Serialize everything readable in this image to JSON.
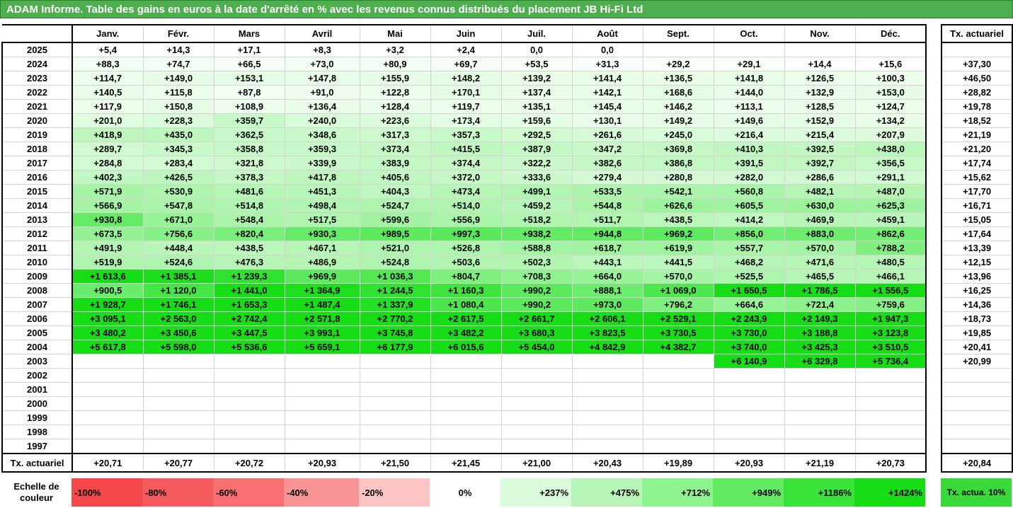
{
  "title": "ADAM Informe. Table des gains en euros à la date d'arrêté en % avec les revenus connus distribués du placement JB Hi-Fi Ltd",
  "months": [
    "Janv.",
    "Févr.",
    "Mars",
    "Avril",
    "Mai",
    "Juin",
    "Juil.",
    "Août",
    "Sept.",
    "Oct.",
    "Nov.",
    "Déc."
  ],
  "side_header": "Tx. actuariel",
  "rows": [
    {
      "year": "2025",
      "cells": [
        "+5,4",
        "+14,3",
        "+17,1",
        "+8,3",
        "+3,2",
        "+2,4",
        "0,0",
        "0,0",
        "",
        "",
        "",
        ""
      ],
      "tx": ""
    },
    {
      "year": "2024",
      "cells": [
        "+88,3",
        "+74,7",
        "+66,5",
        "+73,0",
        "+80,9",
        "+69,7",
        "+53,5",
        "+31,3",
        "+29,2",
        "+29,1",
        "+14,4",
        "+15,6"
      ],
      "tx": "+37,30"
    },
    {
      "year": "2023",
      "cells": [
        "+114,7",
        "+149,0",
        "+153,1",
        "+147,8",
        "+155,9",
        "+148,2",
        "+139,2",
        "+141,4",
        "+136,5",
        "+141,8",
        "+126,5",
        "+100,3"
      ],
      "tx": "+46,50"
    },
    {
      "year": "2022",
      "cells": [
        "+140,5",
        "+115,8",
        "+87,8",
        "+91,0",
        "+122,8",
        "+170,1",
        "+137,4",
        "+142,1",
        "+168,6",
        "+144,0",
        "+132,9",
        "+153,0"
      ],
      "tx": "+28,82"
    },
    {
      "year": "2021",
      "cells": [
        "+117,9",
        "+150,8",
        "+108,9",
        "+136,4",
        "+128,4",
        "+119,7",
        "+135,1",
        "+145,4",
        "+146,2",
        "+113,1",
        "+128,5",
        "+124,7"
      ],
      "tx": "+19,78"
    },
    {
      "year": "2020",
      "cells": [
        "+201,0",
        "+228,3",
        "+359,7",
        "+240,0",
        "+223,6",
        "+173,4",
        "+159,6",
        "+130,1",
        "+149,2",
        "+149,6",
        "+152,9",
        "+134,2"
      ],
      "tx": "+18,52"
    },
    {
      "year": "2019",
      "cells": [
        "+418,9",
        "+435,0",
        "+362,5",
        "+348,6",
        "+317,3",
        "+357,3",
        "+292,5",
        "+261,6",
        "+245,0",
        "+216,4",
        "+215,4",
        "+207,9"
      ],
      "tx": "+21,19"
    },
    {
      "year": "2018",
      "cells": [
        "+289,7",
        "+345,3",
        "+358,8",
        "+359,3",
        "+373,4",
        "+415,5",
        "+387,9",
        "+347,2",
        "+369,8",
        "+410,3",
        "+392,5",
        "+438,0"
      ],
      "tx": "+21,20"
    },
    {
      "year": "2017",
      "cells": [
        "+284,8",
        "+283,4",
        "+321,8",
        "+339,9",
        "+383,9",
        "+374,4",
        "+322,2",
        "+382,6",
        "+386,8",
        "+391,5",
        "+392,7",
        "+356,5"
      ],
      "tx": "+17,74"
    },
    {
      "year": "2016",
      "cells": [
        "+402,3",
        "+426,5",
        "+378,3",
        "+417,8",
        "+405,6",
        "+372,0",
        "+333,6",
        "+279,4",
        "+280,8",
        "+282,0",
        "+286,6",
        "+291,1"
      ],
      "tx": "+15,62"
    },
    {
      "year": "2015",
      "cells": [
        "+571,9",
        "+530,9",
        "+481,6",
        "+451,3",
        "+404,3",
        "+473,4",
        "+499,1",
        "+533,5",
        "+542,1",
        "+560,8",
        "+482,1",
        "+487,0"
      ],
      "tx": "+17,70"
    },
    {
      "year": "2014",
      "cells": [
        "+566,9",
        "+547,8",
        "+514,8",
        "+498,4",
        "+524,7",
        "+514,0",
        "+459,2",
        "+544,8",
        "+626,6",
        "+605,5",
        "+630,0",
        "+625,3"
      ],
      "tx": "+16,71"
    },
    {
      "year": "2013",
      "cells": [
        "+930,8",
        "+671,0",
        "+548,4",
        "+517,5",
        "+599,6",
        "+556,9",
        "+518,2",
        "+511,7",
        "+438,5",
        "+414,2",
        "+469,9",
        "+459,1"
      ],
      "tx": "+15,05"
    },
    {
      "year": "2012",
      "cells": [
        "+673,5",
        "+756,6",
        "+820,4",
        "+930,3",
        "+989,5",
        "+997,3",
        "+938,2",
        "+944,8",
        "+969,2",
        "+856,0",
        "+883,0",
        "+862,6"
      ],
      "tx": "+17,64"
    },
    {
      "year": "2011",
      "cells": [
        "+491,9",
        "+448,4",
        "+438,5",
        "+467,1",
        "+521,0",
        "+526,8",
        "+588,8",
        "+618,7",
        "+619,9",
        "+557,7",
        "+570,0",
        "+788,2"
      ],
      "tx": "+13,39"
    },
    {
      "year": "2010",
      "cells": [
        "+519,9",
        "+524,6",
        "+476,3",
        "+486,9",
        "+524,8",
        "+503,6",
        "+502,3",
        "+443,1",
        "+441,5",
        "+468,2",
        "+471,6",
        "+480,5"
      ],
      "tx": "+12,15"
    },
    {
      "year": "2009",
      "cells": [
        "+1 613,6",
        "+1 385,1",
        "+1 239,3",
        "+969,9",
        "+1 036,3",
        "+804,7",
        "+708,3",
        "+664,0",
        "+570,0",
        "+525,5",
        "+465,5",
        "+466,1"
      ],
      "tx": "+13,96"
    },
    {
      "year": "2008",
      "cells": [
        "+900,5",
        "+1 120,0",
        "+1 441,0",
        "+1 364,9",
        "+1 244,5",
        "+1 160,3",
        "+990,2",
        "+888,1",
        "+1 069,0",
        "+1 650,5",
        "+1 786,5",
        "+1 556,5"
      ],
      "tx": "+16,25"
    },
    {
      "year": "2007",
      "cells": [
        "+1 928,7",
        "+1 746,1",
        "+1 653,3",
        "+1 487,4",
        "+1 337,9",
        "+1 080,4",
        "+990,2",
        "+973,0",
        "+796,2",
        "+664,6",
        "+721,4",
        "+759,6"
      ],
      "tx": "+14,36"
    },
    {
      "year": "2006",
      "cells": [
        "+3 095,1",
        "+2 563,0",
        "+2 742,4",
        "+2 571,8",
        "+2 770,2",
        "+2 617,5",
        "+2 661,7",
        "+2 606,1",
        "+2 529,1",
        "+2 243,9",
        "+2 149,3",
        "+1 947,3"
      ],
      "tx": "+18,73"
    },
    {
      "year": "2005",
      "cells": [
        "+3 480,2",
        "+3 450,6",
        "+3 447,5",
        "+3 993,1",
        "+3 745,8",
        "+3 482,2",
        "+3 680,3",
        "+3 823,5",
        "+3 730,5",
        "+3 730,0",
        "+3 188,8",
        "+3 123,8"
      ],
      "tx": "+19,85"
    },
    {
      "year": "2004",
      "cells": [
        "+5 617,8",
        "+5 598,0",
        "+5 536,6",
        "+5 659,1",
        "+6 177,9",
        "+6 015,6",
        "+5 454,0",
        "+4 842,9",
        "+4 382,7",
        "+3 740,0",
        "+3 425,3",
        "+3 510,5"
      ],
      "tx": "+20,41"
    },
    {
      "year": "2003",
      "cells": [
        "",
        "",
        "",
        "",
        "",
        "",
        "",
        "",
        "",
        "+6 140,9",
        "+6 329,8",
        "+5 736,4"
      ],
      "tx": "+20,99"
    },
    {
      "year": "2002",
      "cells": [
        "",
        "",
        "",
        "",
        "",
        "",
        "",
        "",
        "",
        "",
        "",
        ""
      ],
      "tx": ""
    },
    {
      "year": "2001",
      "cells": [
        "",
        "",
        "",
        "",
        "",
        "",
        "",
        "",
        "",
        "",
        "",
        ""
      ],
      "tx": ""
    },
    {
      "year": "2000",
      "cells": [
        "",
        "",
        "",
        "",
        "",
        "",
        "",
        "",
        "",
        "",
        "",
        ""
      ],
      "tx": ""
    },
    {
      "year": "1999",
      "cells": [
        "",
        "",
        "",
        "",
        "",
        "",
        "",
        "",
        "",
        "",
        "",
        ""
      ],
      "tx": ""
    },
    {
      "year": "1998",
      "cells": [
        "",
        "",
        "",
        "",
        "",
        "",
        "",
        "",
        "",
        "",
        "",
        ""
      ],
      "tx": ""
    },
    {
      "year": "1997",
      "cells": [
        "",
        "",
        "",
        "",
        "",
        "",
        "",
        "",
        "",
        "",
        "",
        ""
      ],
      "tx": ""
    }
  ],
  "footer": {
    "label": "Tx. actuariel",
    "cells": [
      "+20,71",
      "+20,77",
      "+20,72",
      "+20,93",
      "+21,50",
      "+21,45",
      "+21,00",
      "+20,43",
      "+19,89",
      "+20,93",
      "+21,19",
      "+20,73"
    ],
    "tx": "+20,84"
  },
  "scale": {
    "label": "Echelle de couleur",
    "items": [
      {
        "label": "-100%",
        "color": "#f4474a"
      },
      {
        "label": "-80%",
        "color": "#f55b5d"
      },
      {
        "label": "-60%",
        "color": "#f76f71"
      },
      {
        "label": "-40%",
        "color": "#f99496"
      },
      {
        "label": "-20%",
        "color": "#fcc4c5"
      },
      {
        "label": "0%",
        "color": "#ffffff"
      },
      {
        "label": "+237%",
        "color": "#d9fbd9"
      },
      {
        "label": "+475%",
        "color": "#b6f5b6"
      },
      {
        "label": "+712%",
        "color": "#8ef28e"
      },
      {
        "label": "+949%",
        "color": "#63ea63"
      },
      {
        "label": "+1186%",
        "color": "#38e438"
      },
      {
        "label": "+1424%",
        "color": "#16dd16"
      }
    ],
    "side_label": "Tx. actua. 10%",
    "side_color": "#3ad93a"
  }
}
